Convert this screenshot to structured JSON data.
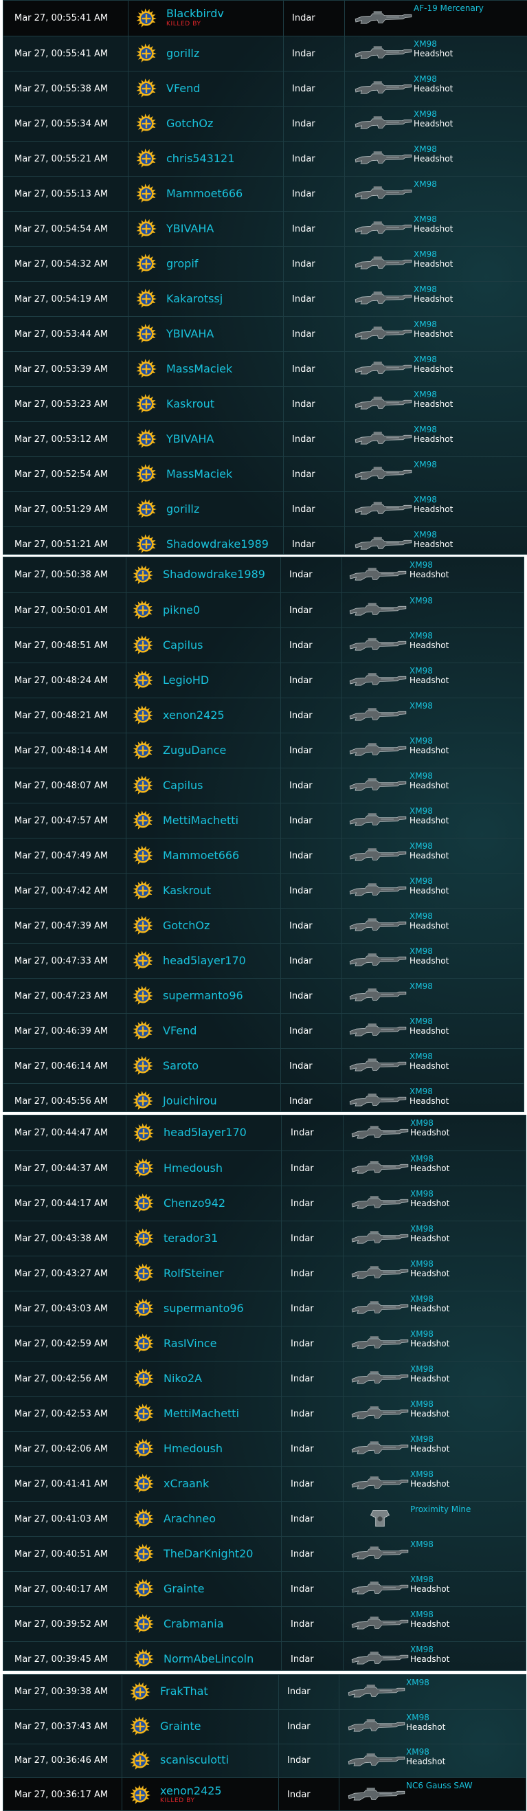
{
  "panels": [
    {
      "rows": [
        {
          "time": "Mar 27, 00:55:41 AM",
          "player": "Blackbirdv",
          "killed_by": "KILLED BY",
          "continent": "Indar",
          "weapon": "AF-19 Mercenary",
          "headshot": "",
          "weapon_icon": "rifle-icon"
        },
        {
          "time": "Mar 27, 00:55:41 AM",
          "player": "gorillz",
          "killed_by": "",
          "continent": "Indar",
          "weapon": "XM98",
          "headshot": "Headshot",
          "weapon_icon": "rifle-icon"
        },
        {
          "time": "Mar 27, 00:55:38 AM",
          "player": "VFend",
          "killed_by": "",
          "continent": "Indar",
          "weapon": "XM98",
          "headshot": "Headshot",
          "weapon_icon": "rifle-icon"
        },
        {
          "time": "Mar 27, 00:55:34 AM",
          "player": "GotchOz",
          "killed_by": "",
          "continent": "Indar",
          "weapon": "XM98",
          "headshot": "Headshot",
          "weapon_icon": "rifle-icon"
        },
        {
          "time": "Mar 27, 00:55:21 AM",
          "player": "chris543121",
          "killed_by": "",
          "continent": "Indar",
          "weapon": "XM98",
          "headshot": "Headshot",
          "weapon_icon": "rifle-icon"
        },
        {
          "time": "Mar 27, 00:55:13 AM",
          "player": "Mammoet666",
          "killed_by": "",
          "continent": "Indar",
          "weapon": "XM98",
          "headshot": "",
          "weapon_icon": "rifle-icon"
        },
        {
          "time": "Mar 27, 00:54:54 AM",
          "player": "YBIVAHA",
          "killed_by": "",
          "continent": "Indar",
          "weapon": "XM98",
          "headshot": "Headshot",
          "weapon_icon": "rifle-icon"
        },
        {
          "time": "Mar 27, 00:54:32 AM",
          "player": "gropif",
          "killed_by": "",
          "continent": "Indar",
          "weapon": "XM98",
          "headshot": "Headshot",
          "weapon_icon": "rifle-icon"
        },
        {
          "time": "Mar 27, 00:54:19 AM",
          "player": "Kakarotssj",
          "killed_by": "",
          "continent": "Indar",
          "weapon": "XM98",
          "headshot": "Headshot",
          "weapon_icon": "rifle-icon"
        },
        {
          "time": "Mar 27, 00:53:44 AM",
          "player": "YBIVAHA",
          "killed_by": "",
          "continent": "Indar",
          "weapon": "XM98",
          "headshot": "Headshot",
          "weapon_icon": "rifle-icon"
        },
        {
          "time": "Mar 27, 00:53:39 AM",
          "player": "MassMaciek",
          "killed_by": "",
          "continent": "Indar",
          "weapon": "XM98",
          "headshot": "Headshot",
          "weapon_icon": "rifle-icon"
        },
        {
          "time": "Mar 27, 00:53:23 AM",
          "player": "Kaskrout",
          "killed_by": "",
          "continent": "Indar",
          "weapon": "XM98",
          "headshot": "Headshot",
          "weapon_icon": "rifle-icon"
        },
        {
          "time": "Mar 27, 00:53:12 AM",
          "player": "YBIVAHA",
          "killed_by": "",
          "continent": "Indar",
          "weapon": "XM98",
          "headshot": "Headshot",
          "weapon_icon": "rifle-icon"
        },
        {
          "time": "Mar 27, 00:52:54 AM",
          "player": "MassMaciek",
          "killed_by": "",
          "continent": "Indar",
          "weapon": "XM98",
          "headshot": "",
          "weapon_icon": "rifle-icon"
        },
        {
          "time": "Mar 27, 00:51:29 AM",
          "player": "gorillz",
          "killed_by": "",
          "continent": "Indar",
          "weapon": "XM98",
          "headshot": "Headshot",
          "weapon_icon": "rifle-icon"
        },
        {
          "time": "Mar 27, 00:51:21 AM",
          "player": "Shadowdrake1989",
          "killed_by": "",
          "continent": "Indar",
          "weapon": "XM98",
          "headshot": "Headshot",
          "weapon_icon": "rifle-icon"
        }
      ]
    },
    {
      "rows": [
        {
          "time": "Mar 27, 00:50:38 AM",
          "player": "Shadowdrake1989",
          "killed_by": "",
          "continent": "Indar",
          "weapon": "XM98",
          "headshot": "Headshot",
          "weapon_icon": "rifle-icon"
        },
        {
          "time": "Mar 27, 00:50:01 AM",
          "player": "pikne0",
          "killed_by": "",
          "continent": "Indar",
          "weapon": "XM98",
          "headshot": "",
          "weapon_icon": "rifle-icon"
        },
        {
          "time": "Mar 27, 00:48:51 AM",
          "player": "Capilus",
          "killed_by": "",
          "continent": "Indar",
          "weapon": "XM98",
          "headshot": "Headshot",
          "weapon_icon": "rifle-icon"
        },
        {
          "time": "Mar 27, 00:48:24 AM",
          "player": "LegioHD",
          "killed_by": "",
          "continent": "Indar",
          "weapon": "XM98",
          "headshot": "Headshot",
          "weapon_icon": "rifle-icon"
        },
        {
          "time": "Mar 27, 00:48:21 AM",
          "player": "xenon2425",
          "killed_by": "",
          "continent": "Indar",
          "weapon": "XM98",
          "headshot": "",
          "weapon_icon": "rifle-icon"
        },
        {
          "time": "Mar 27, 00:48:14 AM",
          "player": "ZuguDance",
          "killed_by": "",
          "continent": "Indar",
          "weapon": "XM98",
          "headshot": "Headshot",
          "weapon_icon": "rifle-icon"
        },
        {
          "time": "Mar 27, 00:48:07 AM",
          "player": "Capilus",
          "killed_by": "",
          "continent": "Indar",
          "weapon": "XM98",
          "headshot": "Headshot",
          "weapon_icon": "rifle-icon"
        },
        {
          "time": "Mar 27, 00:47:57 AM",
          "player": "MettiMachetti",
          "killed_by": "",
          "continent": "Indar",
          "weapon": "XM98",
          "headshot": "Headshot",
          "weapon_icon": "rifle-icon"
        },
        {
          "time": "Mar 27, 00:47:49 AM",
          "player": "Mammoet666",
          "killed_by": "",
          "continent": "Indar",
          "weapon": "XM98",
          "headshot": "Headshot",
          "weapon_icon": "rifle-icon"
        },
        {
          "time": "Mar 27, 00:47:42 AM",
          "player": "Kaskrout",
          "killed_by": "",
          "continent": "Indar",
          "weapon": "XM98",
          "headshot": "Headshot",
          "weapon_icon": "rifle-icon"
        },
        {
          "time": "Mar 27, 00:47:39 AM",
          "player": "GotchOz",
          "killed_by": "",
          "continent": "Indar",
          "weapon": "XM98",
          "headshot": "Headshot",
          "weapon_icon": "rifle-icon"
        },
        {
          "time": "Mar 27, 00:47:33 AM",
          "player": "head5layer170",
          "killed_by": "",
          "continent": "Indar",
          "weapon": "XM98",
          "headshot": "Headshot",
          "weapon_icon": "rifle-icon"
        },
        {
          "time": "Mar 27, 00:47:23 AM",
          "player": "supermanto96",
          "killed_by": "",
          "continent": "Indar",
          "weapon": "XM98",
          "headshot": "",
          "weapon_icon": "rifle-icon"
        },
        {
          "time": "Mar 27, 00:46:39 AM",
          "player": "VFend",
          "killed_by": "",
          "continent": "Indar",
          "weapon": "XM98",
          "headshot": "Headshot",
          "weapon_icon": "rifle-icon"
        },
        {
          "time": "Mar 27, 00:46:14 AM",
          "player": "Saroto",
          "killed_by": "",
          "continent": "Indar",
          "weapon": "XM98",
          "headshot": "Headshot",
          "weapon_icon": "rifle-icon"
        },
        {
          "time": "Mar 27, 00:45:56 AM",
          "player": "Jouichirou",
          "killed_by": "",
          "continent": "Indar",
          "weapon": "XM98",
          "headshot": "Headshot",
          "weapon_icon": "rifle-icon"
        }
      ]
    },
    {
      "rows": [
        {
          "time": "Mar 27, 00:44:47 AM",
          "player": "head5layer170",
          "killed_by": "",
          "continent": "Indar",
          "weapon": "XM98",
          "headshot": "Headshot",
          "weapon_icon": "rifle-icon"
        },
        {
          "time": "Mar 27, 00:44:37 AM",
          "player": "Hmedoush",
          "killed_by": "",
          "continent": "Indar",
          "weapon": "XM98",
          "headshot": "Headshot",
          "weapon_icon": "rifle-icon"
        },
        {
          "time": "Mar 27, 00:44:17 AM",
          "player": "Chenzo942",
          "killed_by": "",
          "continent": "Indar",
          "weapon": "XM98",
          "headshot": "Headshot",
          "weapon_icon": "rifle-icon"
        },
        {
          "time": "Mar 27, 00:43:38 AM",
          "player": "terador31",
          "killed_by": "",
          "continent": "Indar",
          "weapon": "XM98",
          "headshot": "Headshot",
          "weapon_icon": "rifle-icon"
        },
        {
          "time": "Mar 27, 00:43:27 AM",
          "player": "RolfSteiner",
          "killed_by": "",
          "continent": "Indar",
          "weapon": "XM98",
          "headshot": "Headshot",
          "weapon_icon": "rifle-icon"
        },
        {
          "time": "Mar 27, 00:43:03 AM",
          "player": "supermanto96",
          "killed_by": "",
          "continent": "Indar",
          "weapon": "XM98",
          "headshot": "Headshot",
          "weapon_icon": "rifle-icon"
        },
        {
          "time": "Mar 27, 00:42:59 AM",
          "player": "RasIVince",
          "killed_by": "",
          "continent": "Indar",
          "weapon": "XM98",
          "headshot": "Headshot",
          "weapon_icon": "rifle-icon"
        },
        {
          "time": "Mar 27, 00:42:56 AM",
          "player": "Niko2A",
          "killed_by": "",
          "continent": "Indar",
          "weapon": "XM98",
          "headshot": "Headshot",
          "weapon_icon": "rifle-icon"
        },
        {
          "time": "Mar 27, 00:42:53 AM",
          "player": "MettiMachetti",
          "killed_by": "",
          "continent": "Indar",
          "weapon": "XM98",
          "headshot": "Headshot",
          "weapon_icon": "rifle-icon"
        },
        {
          "time": "Mar 27, 00:42:06 AM",
          "player": "Hmedoush",
          "killed_by": "",
          "continent": "Indar",
          "weapon": "XM98",
          "headshot": "Headshot",
          "weapon_icon": "rifle-icon"
        },
        {
          "time": "Mar 27, 00:41:41 AM",
          "player": "xCraank",
          "killed_by": "",
          "continent": "Indar",
          "weapon": "XM98",
          "headshot": "Headshot",
          "weapon_icon": "rifle-icon"
        },
        {
          "time": "Mar 27, 00:41:03 AM",
          "player": "Arachneo",
          "killed_by": "",
          "continent": "Indar",
          "weapon": "Proximity Mine",
          "headshot": "",
          "weapon_icon": "mine-icon"
        },
        {
          "time": "Mar 27, 00:40:51 AM",
          "player": "TheDarKnight20",
          "killed_by": "",
          "continent": "Indar",
          "weapon": "XM98",
          "headshot": "",
          "weapon_icon": "rifle-icon"
        },
        {
          "time": "Mar 27, 00:40:17 AM",
          "player": "Grainte",
          "killed_by": "",
          "continent": "Indar",
          "weapon": "XM98",
          "headshot": "Headshot",
          "weapon_icon": "rifle-icon"
        },
        {
          "time": "Mar 27, 00:39:52 AM",
          "player": "Crabmania",
          "killed_by": "",
          "continent": "Indar",
          "weapon": "XM98",
          "headshot": "Headshot",
          "weapon_icon": "rifle-icon"
        },
        {
          "time": "Mar 27, 00:39:45 AM",
          "player": "NormAbeLincoln",
          "killed_by": "",
          "continent": "Indar",
          "weapon": "XM98",
          "headshot": "Headshot",
          "weapon_icon": "rifle-icon"
        }
      ]
    },
    {
      "rows": [
        {
          "time": "Mar 27, 00:39:38 AM",
          "player": "FrakThat",
          "killed_by": "",
          "continent": "Indar",
          "weapon": "XM98",
          "headshot": "",
          "weapon_icon": "rifle-icon"
        },
        {
          "time": "Mar 27, 00:37:43 AM",
          "player": "Grainte",
          "killed_by": "",
          "continent": "Indar",
          "weapon": "XM98",
          "headshot": "Headshot",
          "weapon_icon": "rifle-icon"
        },
        {
          "time": "Mar 27, 00:36:46 AM",
          "player": "scanisculotti",
          "killed_by": "",
          "continent": "Indar",
          "weapon": "XM98",
          "headshot": "Headshot",
          "weapon_icon": "rifle-icon"
        },
        {
          "time": "Mar 27, 00:36:17 AM",
          "player": "xenon2425",
          "killed_by": "KILLED BY",
          "continent": "Indar",
          "weapon": "NC6 Gauss SAW",
          "headshot": "",
          "weapon_icon": "rifle-icon"
        }
      ]
    }
  ]
}
